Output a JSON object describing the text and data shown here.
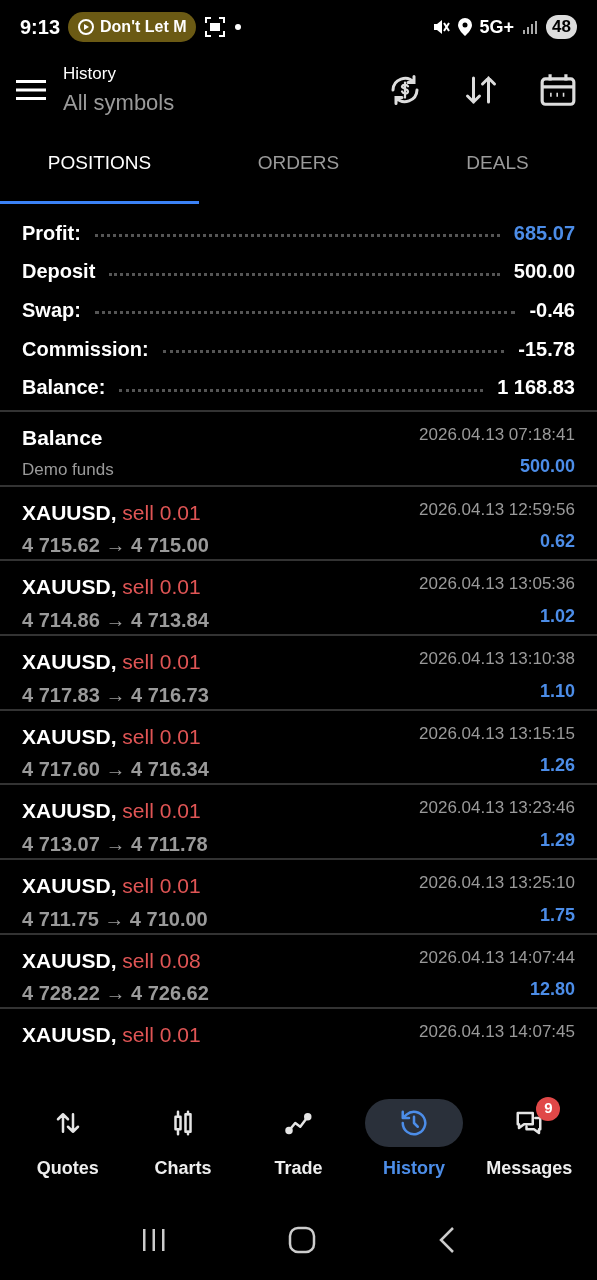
{
  "status_bar": {
    "time": "9:13",
    "media_pill": "Don't Let M",
    "network": "5G+",
    "battery": "48"
  },
  "header": {
    "title": "History",
    "subtitle": "All symbols"
  },
  "tabs": [
    {
      "label": "POSITIONS",
      "selected": true
    },
    {
      "label": "ORDERS",
      "selected": false
    },
    {
      "label": "DEALS",
      "selected": false
    }
  ],
  "summary": [
    {
      "label": "Profit:",
      "value": "685.07",
      "highlight": true
    },
    {
      "label": "Deposit",
      "value": "500.00",
      "highlight": false
    },
    {
      "label": "Swap:",
      "value": "-0.46",
      "highlight": false
    },
    {
      "label": "Commission:",
      "value": "-15.78",
      "highlight": false
    },
    {
      "label": "Balance:",
      "value": "1 168.83",
      "highlight": false
    }
  ],
  "entries": [
    {
      "kind": "balance",
      "title": "Balance",
      "comment": "Demo funds",
      "time": "2026.04.13 07:18:41",
      "amount": "500.00",
      "loss": false
    },
    {
      "kind": "trade",
      "symbol": "XAUUSD,",
      "side": "sell 0.01",
      "prices": "4 715.62 → 4 715.00",
      "time": "2026.04.13 12:59:56",
      "amount": "0.62",
      "loss": false
    },
    {
      "kind": "trade",
      "symbol": "XAUUSD,",
      "side": "sell 0.01",
      "prices": "4 714.86 → 4 713.84",
      "time": "2026.04.13 13:05:36",
      "amount": "1.02",
      "loss": false
    },
    {
      "kind": "trade",
      "symbol": "XAUUSD,",
      "side": "sell 0.01",
      "prices": "4 717.83 → 4 716.73",
      "time": "2026.04.13 13:10:38",
      "amount": "1.10",
      "loss": false
    },
    {
      "kind": "trade",
      "symbol": "XAUUSD,",
      "side": "sell 0.01",
      "prices": "4 717.60 → 4 716.34",
      "time": "2026.04.13 13:15:15",
      "amount": "1.26",
      "loss": false
    },
    {
      "kind": "trade",
      "symbol": "XAUUSD,",
      "side": "sell 0.01",
      "prices": "4 713.07 → 4 711.78",
      "time": "2026.04.13 13:23:46",
      "amount": "1.29",
      "loss": false
    },
    {
      "kind": "trade",
      "symbol": "XAUUSD,",
      "side": "sell 0.01",
      "prices": "4 711.75 → 4 710.00",
      "time": "2026.04.13 13:25:10",
      "amount": "1.75",
      "loss": false
    },
    {
      "kind": "trade",
      "symbol": "XAUUSD,",
      "side": "sell 0.08",
      "prices": "4 728.22 → 4 726.62",
      "time": "2026.04.13 14:07:44",
      "amount": "12.80",
      "loss": false
    },
    {
      "kind": "trade",
      "symbol": "XAUUSD,",
      "side": "sell 0.01",
      "time": "2026.04.13 14:07:45"
    }
  ],
  "bottom_nav": [
    {
      "label": "Quotes",
      "selected": false
    },
    {
      "label": "Charts",
      "selected": false
    },
    {
      "label": "Trade",
      "selected": false
    },
    {
      "label": "History",
      "selected": true
    },
    {
      "label": "Messages",
      "selected": false,
      "badge": "9"
    }
  ]
}
